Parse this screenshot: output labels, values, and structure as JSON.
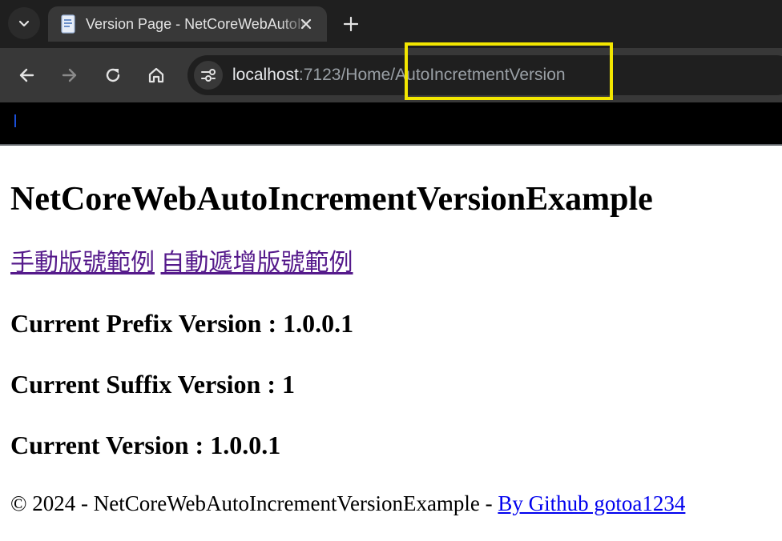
{
  "browser": {
    "tab": {
      "title": "Version Page - NetCoreWebAutoIncrementVersionExample",
      "favicon": "document-icon"
    },
    "address": {
      "host": "localhost",
      "rest": ":7123/Home/AutoIncretmentVersion"
    },
    "icons": [
      "tab-search-icon",
      "close-icon",
      "plus-icon",
      "back-arrow-icon",
      "forward-arrow-icon",
      "reload-icon",
      "home-icon",
      "site-info-icon"
    ],
    "colors": {
      "tabstrip": "#1f1f1f",
      "toolbar": "#383838",
      "omnibox": "#1f1f1f",
      "highlight": "#f2e600"
    }
  },
  "page": {
    "heading": "NetCoreWebAutoIncrementVersionExample",
    "links": {
      "manual": "手動版號範例",
      "auto": "自動遞增版號範例"
    },
    "versions": {
      "prefix": "Current Prefix Version : 1.0.0.1",
      "suffix": "Current Suffix Version : 1",
      "current": "Current Version : 1.0.0.1"
    },
    "footer": {
      "text": "© 2024 - NetCoreWebAutoIncrementVersionExample - ",
      "link": "By Github gotoa1234"
    },
    "colors": {
      "visited_link": "#551a8b",
      "link": "#0000ee"
    }
  }
}
